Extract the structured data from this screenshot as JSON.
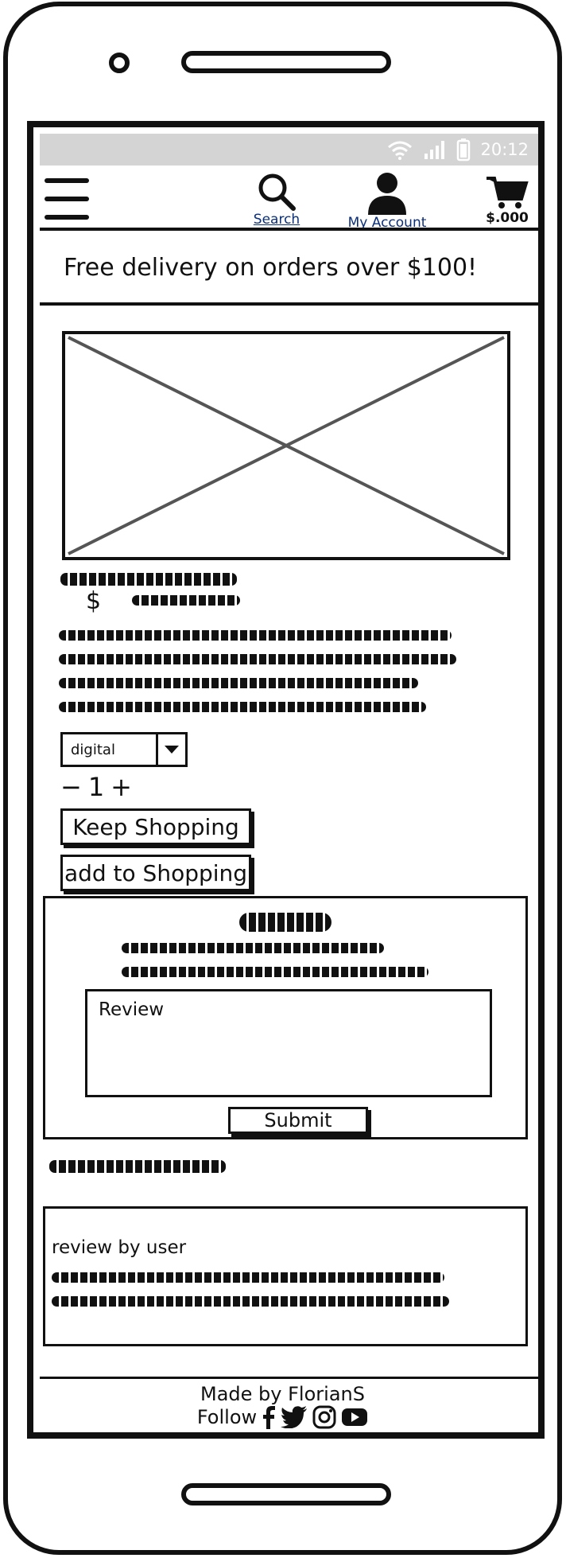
{
  "status_bar": {
    "time": "20:12",
    "icons": [
      "wifi-icon",
      "signal-icon",
      "battery-icon"
    ]
  },
  "header": {
    "menu_icon": "hamburger-icon",
    "search_label": "Search",
    "account_label": "My Account",
    "cart_total": "$.000"
  },
  "banner": {
    "text": "Free delivery on orders over $100!"
  },
  "product": {
    "price_symbol": "$",
    "variant": {
      "selected": "digital"
    },
    "quantity": {
      "minus": "−",
      "value": "1",
      "plus": "+"
    },
    "keep_shopping_label": "Keep Shopping",
    "add_label": "add to Shopping"
  },
  "review_form": {
    "placeholder": "Review",
    "submit_label": "Submit"
  },
  "reviews": [
    {
      "by": "review by user"
    }
  ],
  "footer": {
    "made_by": "Made by FlorianS",
    "follow_label": "Follow",
    "social": [
      "facebook-icon",
      "twitter-icon",
      "instagram-icon",
      "youtube-icon"
    ]
  },
  "colors": {
    "link": "#0b2f78",
    "status_bar": "#d4d4d4",
    "ink": "#111111"
  }
}
